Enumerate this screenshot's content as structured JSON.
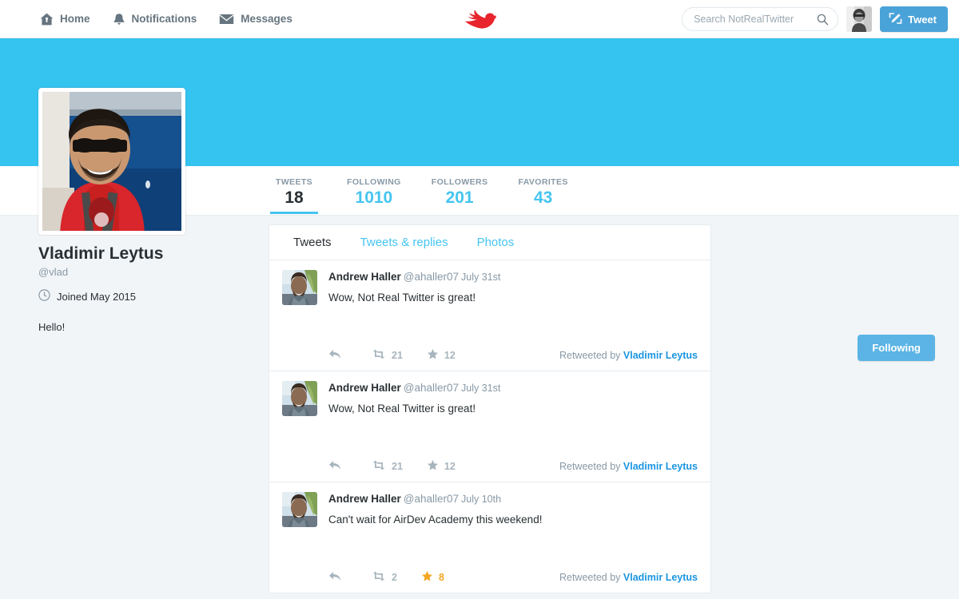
{
  "nav": {
    "items": [
      {
        "label": "Home",
        "icon": "home-icon"
      },
      {
        "label": "Notifications",
        "icon": "bell-icon"
      },
      {
        "label": "Messages",
        "icon": "envelope-icon"
      }
    ],
    "logo_icon": "bird-logo",
    "logo_color": "#e8242c"
  },
  "search": {
    "placeholder": "Search NotRealTwitter",
    "value": "",
    "icon": "search-icon"
  },
  "account": {
    "avatar_icon": "user-avatar",
    "tweet_button": "Tweet",
    "tweet_button_icon": "compose-icon",
    "tweet_button_color": "#4aa3d8"
  },
  "theme": {
    "banner_color": "#35c3ef",
    "accent_blue": "#45c5f0",
    "link_blue": "#1b95e0",
    "favorite_orange": "#f5a623",
    "page_background": "#f2f5f8"
  },
  "profile": {
    "photo_icon": "profile-photo",
    "name": "Vladimir Leytus",
    "handle": "@vlad",
    "joined": "Joined May 2015",
    "joined_icon": "clock-icon",
    "bio": "Hello!",
    "follow_button": "Following"
  },
  "stats": [
    {
      "label": "TWEETS",
      "value": "18",
      "active": true
    },
    {
      "label": "FOLLOWING",
      "value": "1010",
      "active": false
    },
    {
      "label": "FOLLOWERS",
      "value": "201",
      "active": false
    },
    {
      "label": "FAVORITES",
      "value": "43",
      "active": false
    }
  ],
  "tabs": [
    {
      "label": "Tweets",
      "active": true
    },
    {
      "label": "Tweets & replies",
      "active": false
    },
    {
      "label": "Photos",
      "active": false
    }
  ],
  "tweets": [
    {
      "author": "Andrew Haller",
      "handle": "@ahaller07",
      "date": "July 31st",
      "text": "Wow, Not Real Twitter is great!",
      "reply_icon": "reply-icon",
      "retweet_icon": "retweet-icon",
      "retweet_count": "21",
      "favorite_icon": "star-icon",
      "favorite_count": "12",
      "favorited": false,
      "retweeted_by_prefix": "Retweeted by",
      "retweeted_by_name": "Vladimir Leytus"
    },
    {
      "author": "Andrew Haller",
      "handle": "@ahaller07",
      "date": "July 31st",
      "text": "Wow, Not Real Twitter is great!",
      "reply_icon": "reply-icon",
      "retweet_icon": "retweet-icon",
      "retweet_count": "21",
      "favorite_icon": "star-icon",
      "favorite_count": "12",
      "favorited": false,
      "retweeted_by_prefix": "Retweeted by",
      "retweeted_by_name": "Vladimir Leytus"
    },
    {
      "author": "Andrew Haller",
      "handle": "@ahaller07",
      "date": "July 10th",
      "text": "Can't wait for AirDev Academy this weekend!",
      "reply_icon": "reply-icon",
      "retweet_icon": "retweet-icon",
      "retweet_count": "2",
      "favorite_icon": "star-icon",
      "favorite_count": "8",
      "favorited": true,
      "retweeted_by_prefix": "Retweeted by",
      "retweeted_by_name": "Vladimir Leytus"
    }
  ]
}
